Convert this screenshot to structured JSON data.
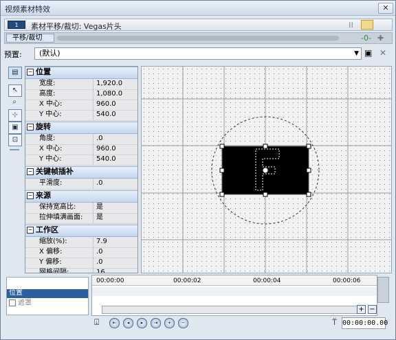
{
  "window": {
    "title": "视频素材特效",
    "close_glyph": "✕"
  },
  "header": {
    "chip": "1",
    "title": "素材平移/裁切: Vegas片头",
    "grid_glyph": "⁞⁞"
  },
  "fx_chain": {
    "label": "平移/裁切"
  },
  "preset": {
    "label": "预置:",
    "value": "(默认)",
    "arrow": "▼",
    "save_glyph": "▣",
    "delete_glyph": "✕"
  },
  "sections": [
    {
      "title": "位置",
      "rows": [
        {
          "k": "宽度:",
          "v": "1,920.0"
        },
        {
          "k": "高度:",
          "v": "1,080.0"
        },
        {
          "k": "X 中心:",
          "v": "960.0"
        },
        {
          "k": "Y 中心:",
          "v": "540.0"
        }
      ]
    },
    {
      "title": "旋转",
      "rows": [
        {
          "k": "角度:",
          "v": ".0"
        },
        {
          "k": "X 中心:",
          "v": "960.0"
        },
        {
          "k": "Y 中心:",
          "v": "540.0"
        }
      ]
    },
    {
      "title": "关键帧插补",
      "rows": [
        {
          "k": "平滑度:",
          "v": ".0"
        }
      ]
    },
    {
      "title": "来源",
      "rows": [
        {
          "k": "保持宽高比:",
          "v": "是"
        },
        {
          "k": "拉伸填满画面:",
          "v": "是"
        }
      ]
    },
    {
      "title": "工作区",
      "rows": [
        {
          "k": "缩放(%):",
          "v": "7.9"
        },
        {
          "k": "X 偏移:",
          "v": ".0"
        },
        {
          "k": "Y 偏移:",
          "v": ".0"
        },
        {
          "k": "网格间隔:",
          "v": "16"
        }
      ]
    }
  ],
  "timeline": {
    "track_label": "位置",
    "mask_label": "遮罩",
    "ticks": [
      "00:00:00",
      "00:00:02",
      "00:00:04",
      "00:00:06"
    ],
    "time": "00:00:00.00"
  },
  "toolbar": {
    "plus": "+",
    "minus": "−"
  }
}
